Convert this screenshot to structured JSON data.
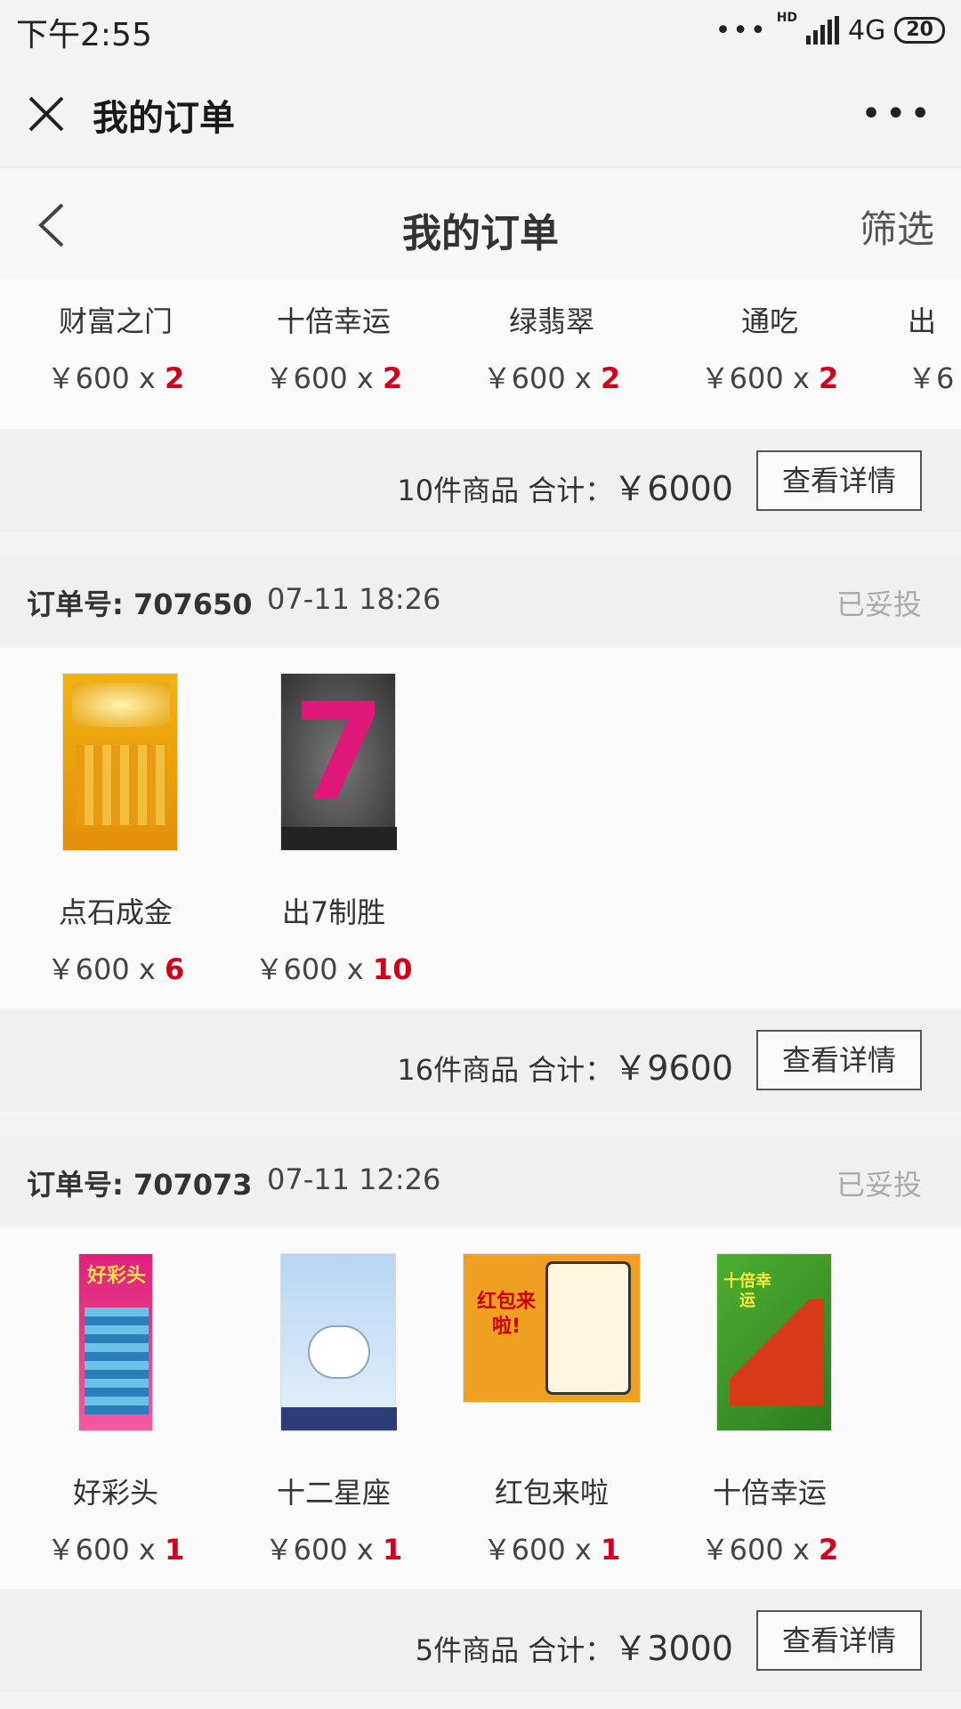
{
  "status": {
    "time": "下午2:55",
    "network": "4G",
    "network_hd": "HD",
    "battery": "20"
  },
  "titlebar": {
    "title": "我的订单"
  },
  "header": {
    "title": "我的订单",
    "filter_label": "筛选"
  },
  "orders": [
    {
      "items": [
        {
          "name": "财富之门",
          "price": "￥600 x ",
          "qty": "2"
        },
        {
          "name": "十倍幸运",
          "price": "￥600 x ",
          "qty": "2"
        },
        {
          "name": "绿翡翠",
          "price": "￥600 x ",
          "qty": "2"
        },
        {
          "name": "通吃",
          "price": "￥600 x ",
          "qty": "2"
        },
        {
          "name": "出",
          "price": "￥6",
          "qty": ""
        }
      ],
      "summary": {
        "count_label": "10件商品 合计：",
        "total": "￥6000",
        "button": "查看详情"
      }
    },
    {
      "label": "订单号: 707650",
      "time": "07-11 18:26",
      "status": "已妥投",
      "items": [
        {
          "name": "点石成金",
          "price": "￥600 x ",
          "qty": "6",
          "thumb": "gold"
        },
        {
          "name": "出7制胜",
          "price": "￥600 x ",
          "qty": "10",
          "thumb": "seven",
          "thumb_text": "7"
        }
      ],
      "summary": {
        "count_label": "16件商品 合计：",
        "total": "￥9600",
        "button": "查看详情"
      }
    },
    {
      "label": "订单号: 707073",
      "time": "07-11 12:26",
      "status": "已妥投",
      "items": [
        {
          "name": "好彩头",
          "price": "￥600 x ",
          "qty": "1",
          "thumb": "haocaitou",
          "thumb_text": "好彩头"
        },
        {
          "name": "十二星座",
          "price": "￥600 x ",
          "qty": "1",
          "thumb": "zodiac"
        },
        {
          "name": "红包来啦",
          "price": "￥600 x ",
          "qty": "1",
          "thumb": "hongbao",
          "thumb_text": "红包来啦!"
        },
        {
          "name": "十倍幸运",
          "price": "￥600 x ",
          "qty": "2",
          "thumb": "lucky",
          "thumb_text": "十倍幸运"
        }
      ],
      "summary": {
        "count_label": "5件商品 合计：",
        "total": "￥3000",
        "button": "查看详情"
      }
    }
  ],
  "colors": {
    "qty_red": "#d0021b",
    "background": "#f3f3f3"
  }
}
